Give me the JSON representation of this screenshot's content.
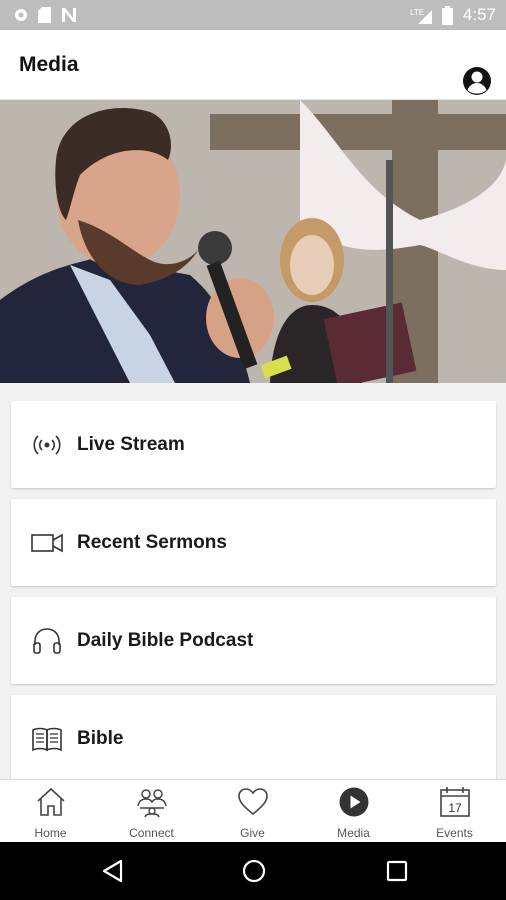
{
  "status": {
    "time": "4:57",
    "network": "LTE"
  },
  "header": {
    "title": "Media"
  },
  "menu": {
    "items": [
      {
        "label": "Live Stream",
        "icon": "live-stream-icon"
      },
      {
        "label": "Recent Sermons",
        "icon": "video-camera-icon"
      },
      {
        "label": "Daily Bible Podcast",
        "icon": "headphones-icon"
      },
      {
        "label": "Bible",
        "icon": "book-icon"
      }
    ]
  },
  "tabs": [
    {
      "label": "Home",
      "icon": "home-icon"
    },
    {
      "label": "Connect",
      "icon": "people-icon"
    },
    {
      "label": "Give",
      "icon": "heart-icon"
    },
    {
      "label": "Media",
      "icon": "play-icon",
      "active": true
    },
    {
      "label": "Events",
      "icon": "calendar-icon",
      "day": "17"
    }
  ]
}
